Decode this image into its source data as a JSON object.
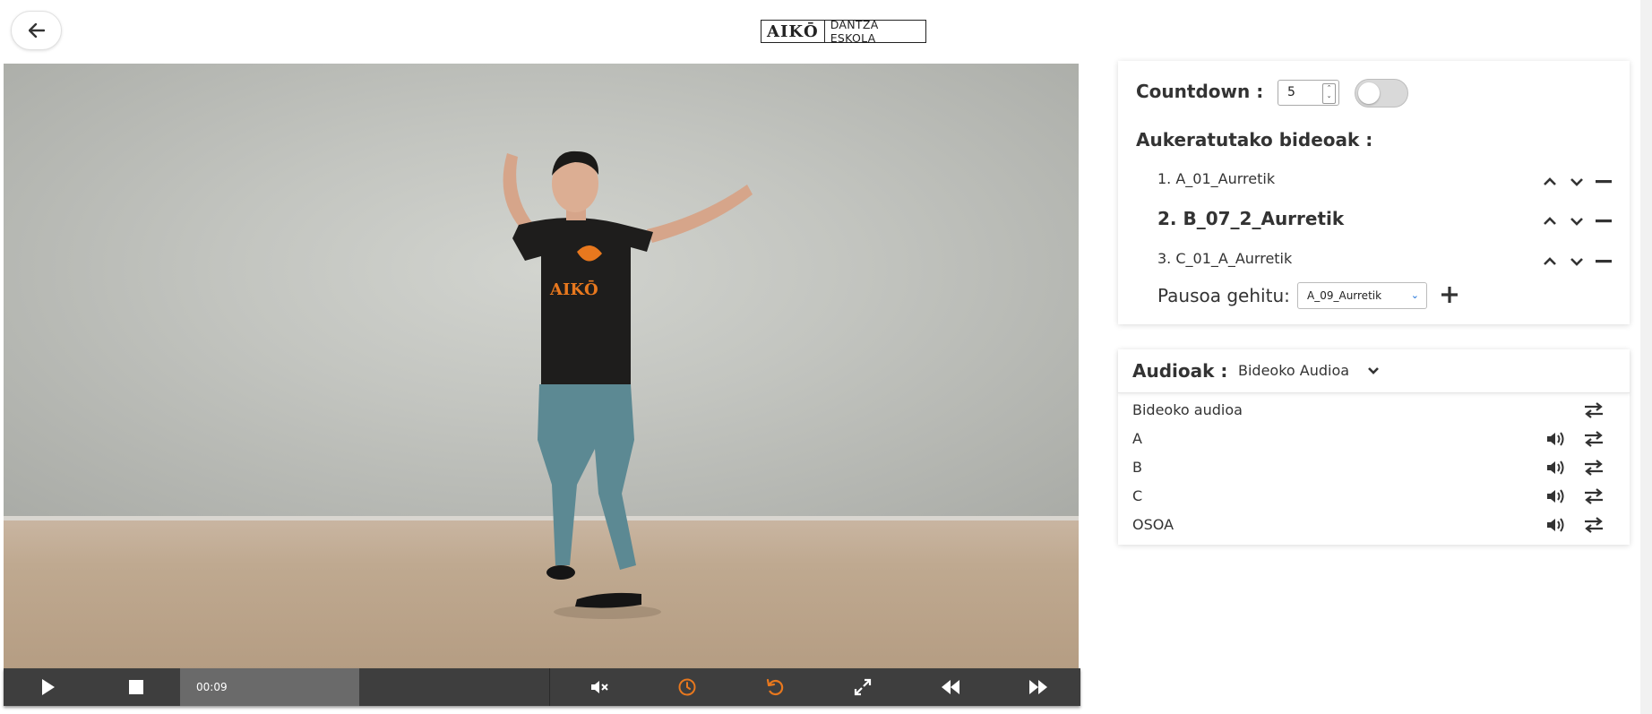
{
  "header": {
    "logo_brand": "AIKŌ",
    "logo_sub": "DANTZA ESKOLA"
  },
  "player": {
    "time": "00:09",
    "progress": 0.2
  },
  "countdown": {
    "label": "Countdown :",
    "value": "5",
    "enabled": false
  },
  "selected": {
    "label": "Aukeratutako bideoak :",
    "items": [
      {
        "label": "1. A_01_Aurretik",
        "active": false
      },
      {
        "label": "2. B_07_2_Aurretik",
        "active": true
      },
      {
        "label": "3. C_01_A_Aurretik",
        "active": false
      }
    ],
    "add_label": "Pausoa gehitu:",
    "add_select_value": "A_09_Aurretik"
  },
  "audio": {
    "label": "Audioak :",
    "selected": "Bideoko Audioa",
    "rows": [
      {
        "label": "Bideoko audioa",
        "volume": false
      },
      {
        "label": "A",
        "volume": true
      },
      {
        "label": "B",
        "volume": true
      },
      {
        "label": "C",
        "volume": true
      },
      {
        "label": "OSOA",
        "volume": true
      }
    ]
  },
  "colors": {
    "accent_orange": "#e8781e",
    "controls_bg": "#3e3e3e",
    "shirt": "#1e1d1c",
    "jeans": "#5c8993"
  }
}
